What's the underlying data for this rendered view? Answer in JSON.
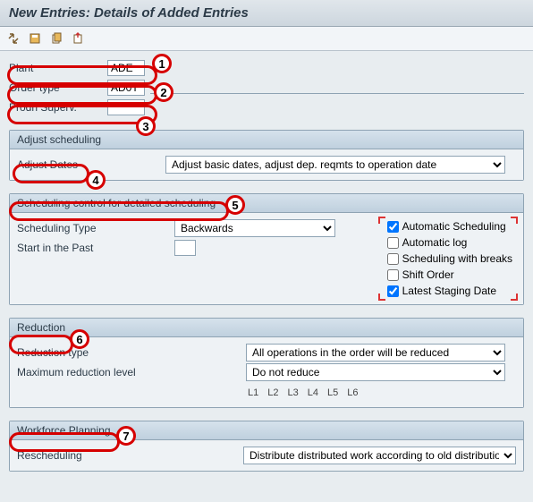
{
  "title": "New Entries: Details of Added Entries",
  "fields": {
    "plant": {
      "label": "Plant",
      "value": "ADE"
    },
    "order": {
      "label": "Order type",
      "value": "AD0T"
    },
    "prodn": {
      "label": "Prodn Superv.",
      "value": "*"
    }
  },
  "adjust": {
    "title": "Adjust scheduling",
    "row_label": "Adjust Dates",
    "value": "Adjust basic dates, adjust dep. reqmts to operation date"
  },
  "sched": {
    "title": "Scheduling control for detailed scheduling",
    "type_label": "Scheduling Type",
    "type_value": "Backwards",
    "start_label": "Start in the Past",
    "start_value": "",
    "checks": {
      "auto_sched": {
        "label": "Automatic Scheduling",
        "checked": true
      },
      "auto_log": {
        "label": "Automatic log",
        "checked": false
      },
      "breaks": {
        "label": "Scheduling with breaks",
        "checked": false
      },
      "shift": {
        "label": "Shift Order",
        "checked": false
      },
      "latest": {
        "label": "Latest Staging Date",
        "checked": true
      }
    }
  },
  "reduction": {
    "title": "Reduction",
    "type_label": "Reduction type",
    "type_value": "All operations in the order will be reduced",
    "max_label": "Maximum reduction level",
    "max_value": "Do not reduce",
    "levels": [
      "L1",
      "L2",
      "L3",
      "L4",
      "L5",
      "L6"
    ]
  },
  "workforce": {
    "title": "Workforce Planning",
    "resched_label": "Rescheduling",
    "resched_value": "Distribute distributed work according to old distribution"
  },
  "ann": {
    "1": "1",
    "2": "2",
    "3": "3",
    "4": "4",
    "5": "5",
    "6": "6",
    "7": "7"
  }
}
